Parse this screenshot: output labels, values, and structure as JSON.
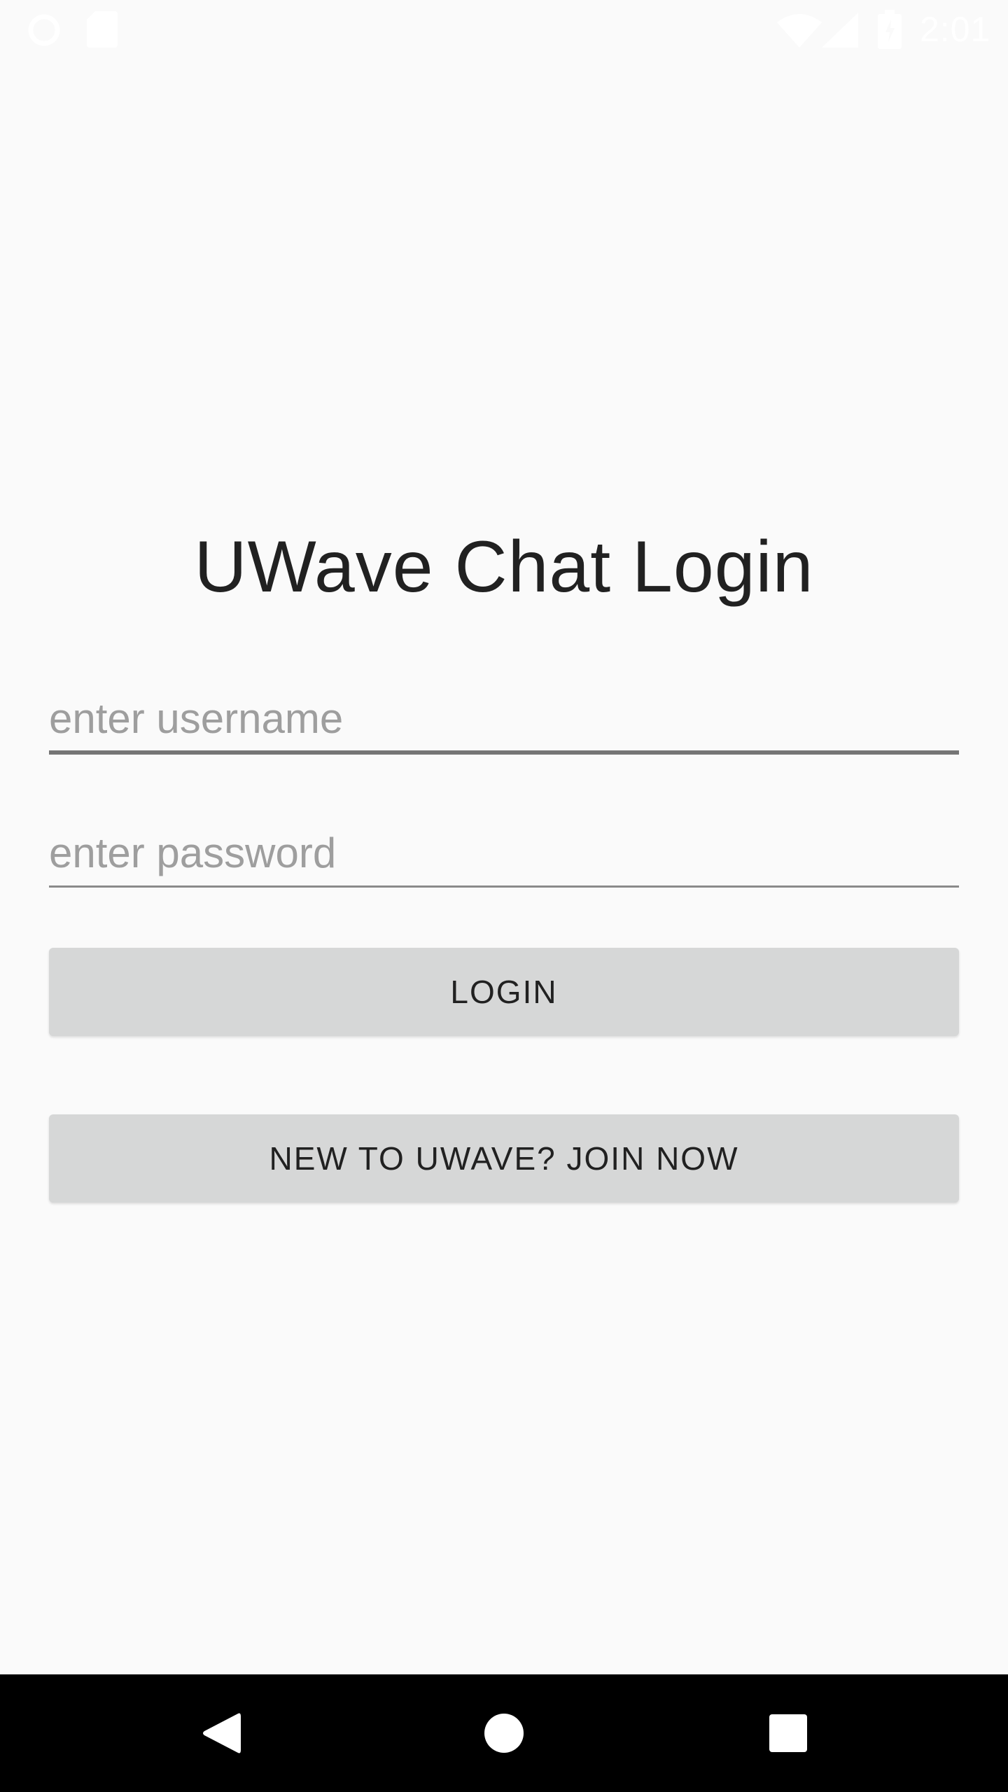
{
  "status_bar": {
    "time": "2:01",
    "icons": [
      "sync-icon",
      "sd-card-icon",
      "wifi-icon",
      "cell-signal-icon",
      "battery-charging-icon"
    ]
  },
  "login": {
    "title": "UWave Chat Login",
    "username": {
      "value": "",
      "placeholder": "enter username"
    },
    "password": {
      "value": "",
      "placeholder": "enter password"
    },
    "login_label": "LOGIN",
    "join_label": "NEW TO UWAVE? JOIN NOW"
  },
  "nav_bar": {
    "icons": [
      "back-icon",
      "home-icon",
      "recents-icon"
    ]
  },
  "colors": {
    "background": "#fafafa",
    "button": "#d6d7d7",
    "text": "#212121",
    "placeholder": "#9e9e9e",
    "nav_bar": "#000000"
  }
}
